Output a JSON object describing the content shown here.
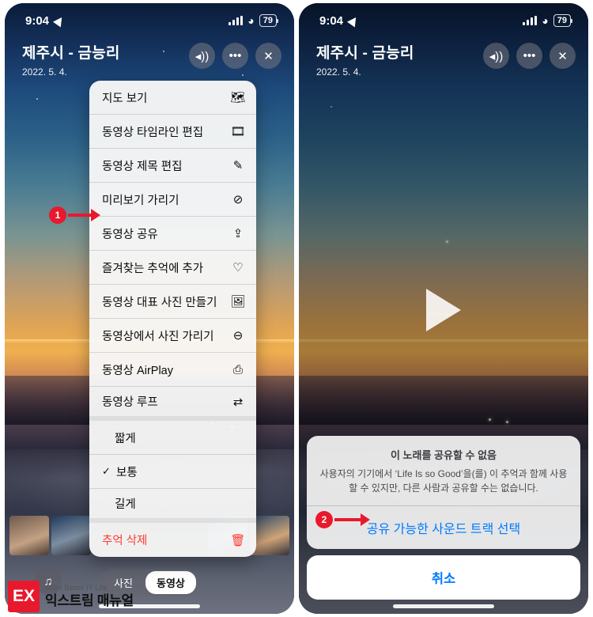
{
  "status_bar": {
    "time": "9:04",
    "battery": "79",
    "location_icon": "location-arrow-icon",
    "signal_icon": "cellular-bars-icon",
    "wifi_icon": "wifi-icon"
  },
  "memory_header": {
    "title": "제주시 - 금능리",
    "date": "2022. 5. 4.",
    "buttons": [
      {
        "name": "mute-button",
        "glyph": "◂))"
      },
      {
        "name": "more-button",
        "glyph": "•••"
      },
      {
        "name": "close-button",
        "glyph": "✕"
      }
    ]
  },
  "context_menu": {
    "items": [
      {
        "label": "지도 보기",
        "icon": "map-icon",
        "glyph": "🗺"
      },
      {
        "label": "동영상 타임라인 편집",
        "icon": "timeline-icon",
        "glyph": "🎞"
      },
      {
        "label": "동영상 제목 편집",
        "icon": "pencil-icon",
        "glyph": "✎"
      },
      {
        "label": "미리보기 가리기",
        "icon": "hide-preview-icon",
        "glyph": "⊘"
      },
      {
        "label": "동영상 공유",
        "icon": "share-icon",
        "glyph": "⇪"
      },
      {
        "label": "즐겨찾는 추억에 추가",
        "icon": "heart-icon",
        "glyph": "♡"
      },
      {
        "label": "동영상 대표 사진 만들기",
        "icon": "key-photo-icon",
        "glyph": "🖼"
      },
      {
        "label": "동영상에서 사진 가리기",
        "icon": "hide-photo-icon",
        "glyph": "⊖"
      },
      {
        "label": "동영상 AirPlay",
        "icon": "airplay-icon",
        "glyph": "⎙"
      },
      {
        "label": "동영상 루프",
        "icon": "loop-icon",
        "glyph": "⇄"
      }
    ],
    "length_options": [
      {
        "label": "짧게",
        "checked": false
      },
      {
        "label": "보통",
        "checked": true
      },
      {
        "label": "길게",
        "checked": false
      }
    ],
    "delete": {
      "label": "추억 삭제",
      "icon": "trash-icon",
      "glyph": "🗑"
    },
    "check_glyph": "✓"
  },
  "tabbar": {
    "music_button_icon": "music-note-icon",
    "music_glyph": "♫",
    "segments": [
      {
        "label": "사진",
        "active": false
      },
      {
        "label": "동영상",
        "active": true
      }
    ]
  },
  "right_phone": {
    "play_button": "play-icon",
    "action_sheet": {
      "title": "이 노래를 공유할 수 없음",
      "message": "사용자의 기기에서 ‘Life Is so Good’을(를) 이 추억과 함께 사용할 수 있지만, 다른 사람과 공유할 수는 없습니다.",
      "primary_action": "공유 가능한 사운드 트랙 선택",
      "cancel_action": "취소"
    }
  },
  "callouts": [
    {
      "number": "1",
      "target": "동영상 공유"
    },
    {
      "number": "2",
      "target": "공유 가능한 사운드 트랙 선택"
    }
  ],
  "watermark": {
    "logo_text": "EX",
    "tagline": "More Better IT Life",
    "brand": "익스트림 매뉴얼"
  },
  "colors": {
    "accent_red": "#e8192c",
    "ios_blue": "#007aff",
    "destructive": "#ff3b30"
  }
}
